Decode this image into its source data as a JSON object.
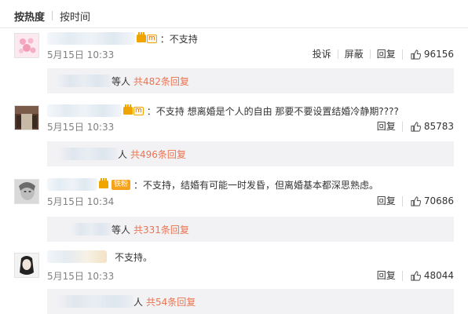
{
  "sort": {
    "hot": "按热度",
    "time": "按时间"
  },
  "action_labels": {
    "report": "投诉",
    "block": "屏蔽",
    "reply": "回复"
  },
  "comments": [
    {
      "text": "：不支持",
      "date": "5月15日 10:33",
      "likes": "96156",
      "replies": {
        "name_tail": "等人",
        "link": "共482条回复"
      }
    },
    {
      "text": "：不支持 想离婚是个人的自由 那要不要设置结婚冷静期????",
      "date": "5月15日 10:33",
      "likes": "85783",
      "replies": {
        "name_tail": "人",
        "link": "共496条回复"
      }
    },
    {
      "badge": "铁粉",
      "text": "：不支持，结婚有可能一时发昏，但离婚基本都深思熟虑。",
      "date": "5月15日 10:34",
      "likes": "70686",
      "replies": {
        "name_tail": "等人",
        "link": "共331条回复"
      }
    },
    {
      "text": "不支持。",
      "date": "5月15日 10:33",
      "likes": "48044",
      "replies": {
        "name_tail": "人",
        "link": "共54条回复"
      }
    }
  ],
  "colors": {
    "accent_link": "#eb7350",
    "reply_bg": "#f2f2f5",
    "vip_gold": "#f0a400"
  }
}
